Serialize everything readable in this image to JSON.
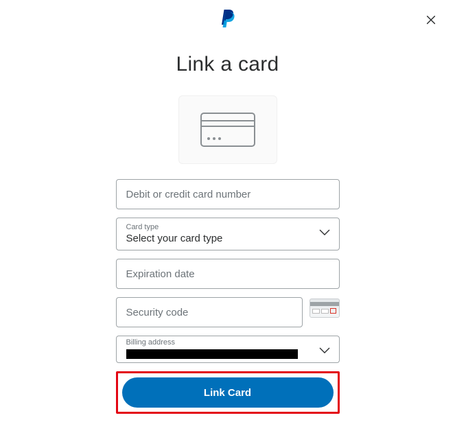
{
  "header": {
    "title": "Link a card"
  },
  "form": {
    "card_number_placeholder": "Debit or credit card number",
    "card_type_label": "Card type",
    "card_type_value": "Select your card type",
    "expiration_placeholder": "Expiration date",
    "security_code_placeholder": "Security code",
    "billing_label": "Billing address",
    "submit_label": "Link Card"
  }
}
